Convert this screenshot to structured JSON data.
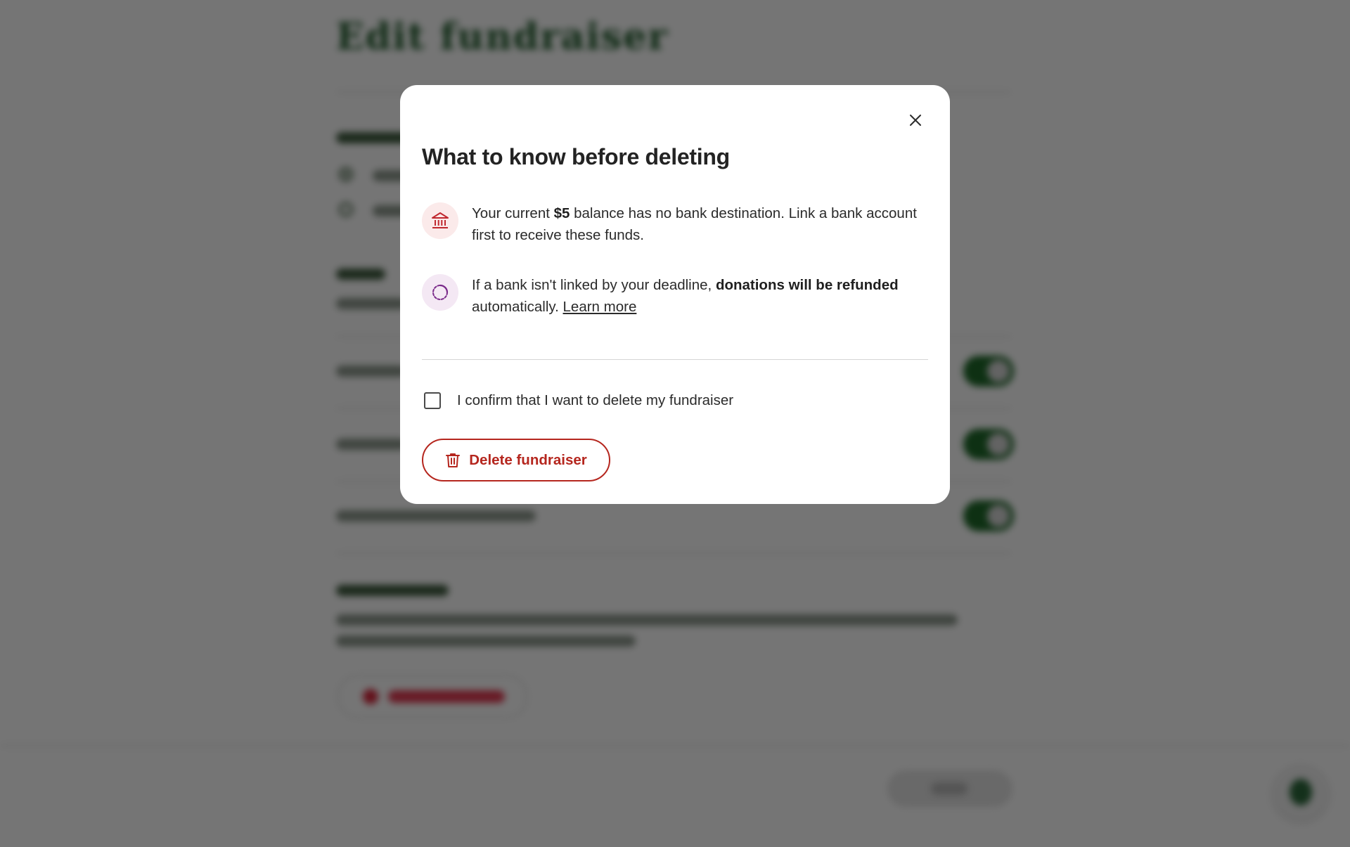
{
  "modal": {
    "title": "What to know before deleting",
    "items": [
      {
        "icon": "bank-icon",
        "text_before": "Your current ",
        "text_bold": "$5",
        "text_after": " balance has no bank destination. Link a bank account first to receive these funds."
      },
      {
        "icon": "loading-timer-icon",
        "text_before": "If a bank isn't linked by your deadline, ",
        "text_bold": "donations will be refunded",
        "text_after": " automatically. ",
        "link": "Learn more"
      }
    ],
    "confirm_label": "I confirm that I want to delete my fundraiser",
    "confirm_checked": false,
    "delete_label": "Delete fundraiser"
  },
  "colors": {
    "danger": "#b5261e",
    "overlay": "rgba(0,0,0,0.54)",
    "bank_icon_bg": "#fbeaea",
    "timer_icon_bg": "#f4e8f4",
    "timer_icon": "#7a2a8a"
  }
}
